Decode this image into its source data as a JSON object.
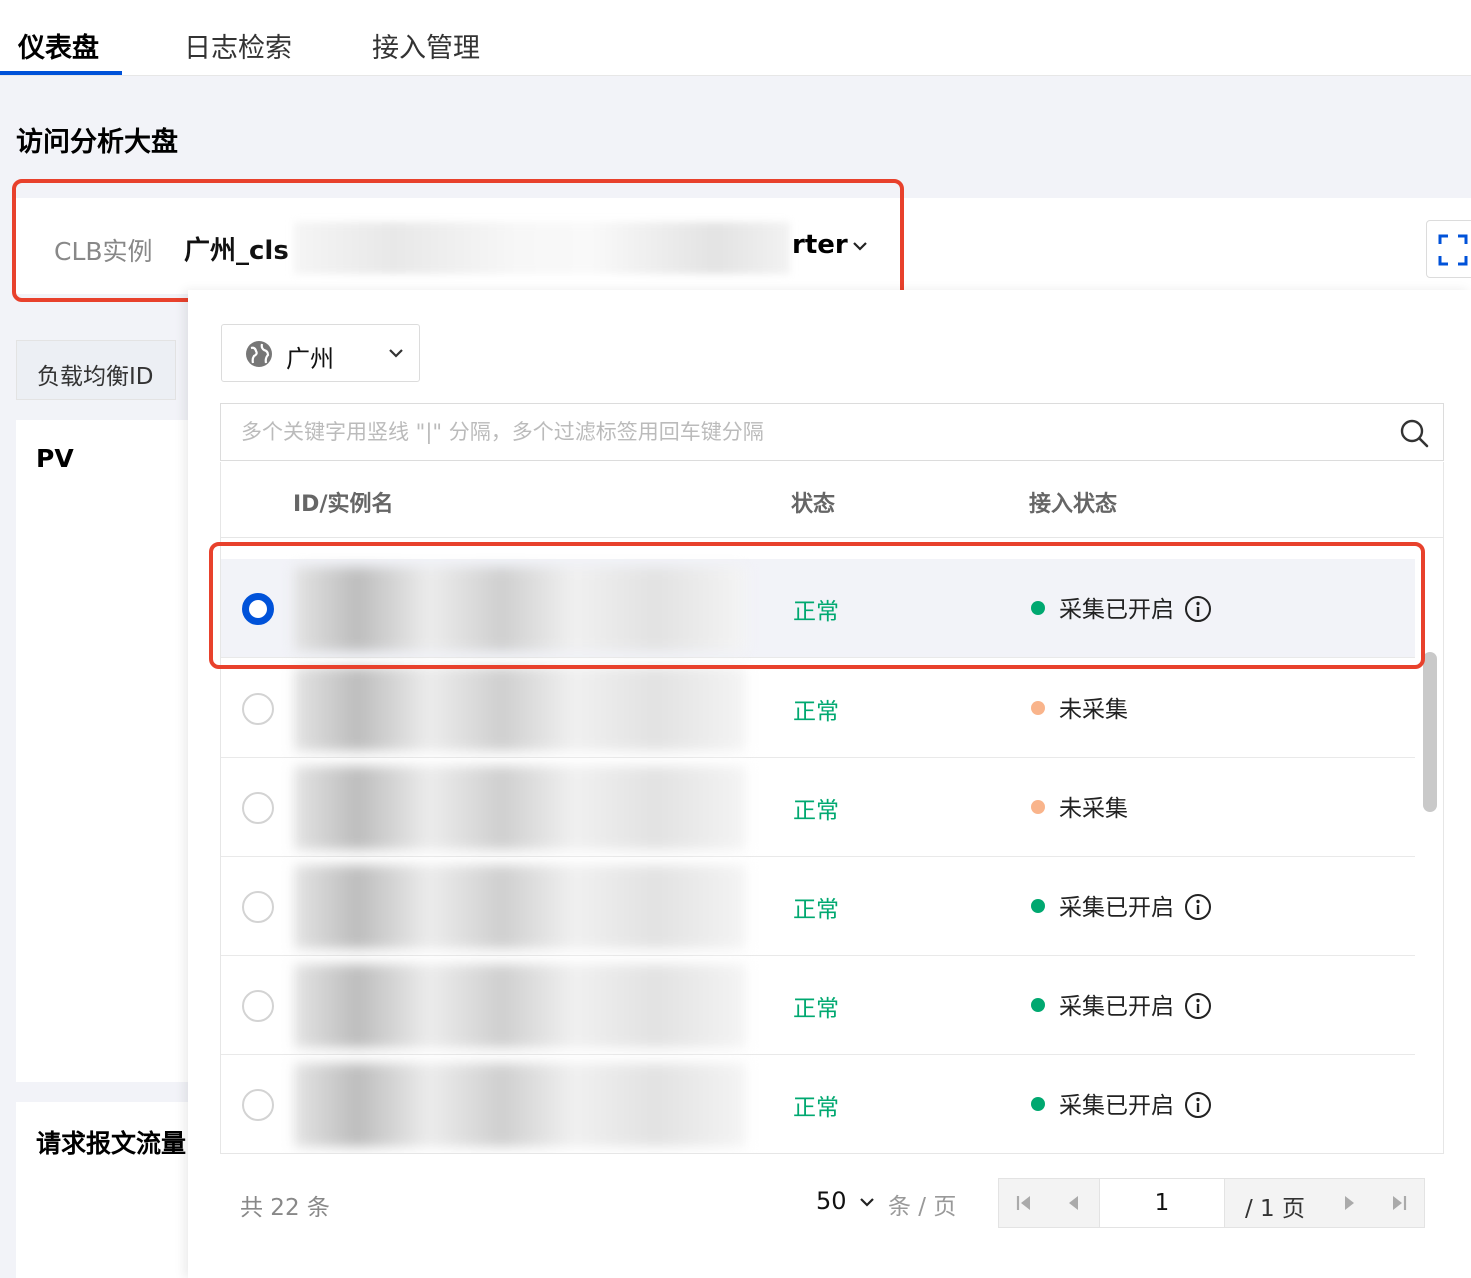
{
  "tabs": [
    {
      "label": "仪表盘",
      "active": true
    },
    {
      "label": "日志检索",
      "active": false
    },
    {
      "label": "接入管理",
      "active": false
    }
  ],
  "page": {
    "title": "访问分析大盘",
    "left_tab": "负载均衡ID",
    "card_pv": "PV",
    "card_req": "请求报文流量"
  },
  "clb": {
    "label": "CLB实例",
    "value_prefix": "广州_cls",
    "value_suffix": "rter"
  },
  "dropdown": {
    "region": "广州",
    "search_placeholder": "多个关键字用竖线 \"|\" 分隔，多个过滤标签用回车键分隔",
    "columns": [
      "ID/实例名",
      "状态",
      "接入状态"
    ],
    "rows": [
      {
        "status": "正常",
        "ingest": "采集已开启",
        "ingest_color": "#00a870",
        "info": true,
        "selected": true
      },
      {
        "status": "正常",
        "ingest": "未采集",
        "ingest_color": "#f9b48b",
        "info": false,
        "selected": false
      },
      {
        "status": "正常",
        "ingest": "未采集",
        "ingest_color": "#f9b48b",
        "info": false,
        "selected": false
      },
      {
        "status": "正常",
        "ingest": "采集已开启",
        "ingest_color": "#00a870",
        "info": true,
        "selected": false
      },
      {
        "status": "正常",
        "ingest": "采集已开启",
        "ingest_color": "#00a870",
        "info": true,
        "selected": false
      },
      {
        "status": "正常",
        "ingest": "采集已开启",
        "ingest_color": "#00a870",
        "info": true,
        "selected": false
      }
    ],
    "pagination": {
      "total": "共 22 条",
      "page_size": "50",
      "per_page": "条 / 页",
      "current": "1",
      "page_total": "/ 1 页"
    }
  },
  "colors": {
    "accent": "#0052d9",
    "ok_green": "#00a870",
    "highlight_red": "#e8412c"
  }
}
